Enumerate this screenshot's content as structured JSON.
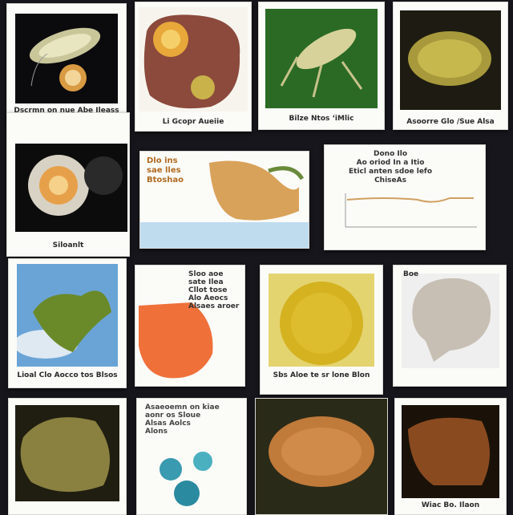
{
  "tiles": [
    {
      "caption": "Dscrmn on nue\nAbe Ileass"
    },
    {
      "caption": "Li Gcopr Aueiie"
    },
    {
      "caption": "Bilze    Ntos  ‘iMlic"
    },
    {
      "caption": "Asoorre Glo /Sue Alsa"
    },
    {
      "caption": "Siloanlt"
    },
    {
      "caption": "Dlo ins\nsae lles\nBtoshao"
    },
    {
      "caption": "Dono Ilo\nAo oriod In a Itio\nEticl anten sdoe lefo\nChiseAs"
    },
    {
      "caption": "Lioal Clo Aocco tos\nBlsos"
    },
    {
      "caption": "Sloo aoe\nsate Ilea\nCllot tose\nAlo Aeocs\nAlsaes aroer"
    },
    {
      "caption": "Sbs Aloe te sr lone\nBlon"
    },
    {
      "caption": "Boe"
    },
    {
      "caption": "Asaeoemn on kiae\naonr os Sloue\nAlsas Aolcs\nAlons"
    },
    {
      "caption": "Wiac Bo. Ilaon"
    }
  ],
  "colors": {
    "background": "#16161c",
    "card": "#fbfbf8"
  }
}
